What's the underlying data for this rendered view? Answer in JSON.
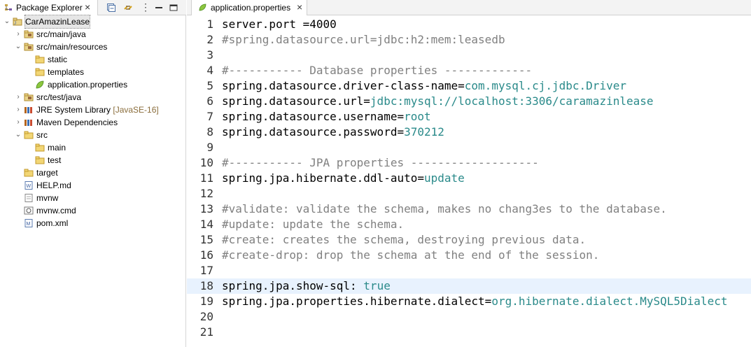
{
  "explorer": {
    "title": "Package Explorer",
    "close": "×",
    "tree": [
      {
        "label": "CarAmazinLease",
        "icon": "project-icon",
        "twisty": "⌄",
        "decoration": ""
      },
      {
        "label": "src/main/java",
        "icon": "source-folder-icon",
        "twisty": "›",
        "decoration": ""
      },
      {
        "label": "src/main/resources",
        "icon": "source-folder-icon",
        "twisty": "⌄",
        "decoration": ""
      },
      {
        "label": "static",
        "icon": "folder-icon",
        "twisty": "",
        "decoration": ""
      },
      {
        "label": "templates",
        "icon": "folder-icon",
        "twisty": "",
        "decoration": ""
      },
      {
        "label": "application.properties",
        "icon": "properties-file-icon",
        "twisty": "",
        "decoration": ""
      },
      {
        "label": "src/test/java",
        "icon": "source-folder-icon",
        "twisty": "›",
        "decoration": ""
      },
      {
        "label": "JRE System Library",
        "icon": "library-icon",
        "twisty": "›",
        "decoration": "[JavaSE-16]"
      },
      {
        "label": "Maven Dependencies",
        "icon": "library-icon",
        "twisty": "›",
        "decoration": ""
      },
      {
        "label": "src",
        "icon": "folder-icon",
        "twisty": "⌄",
        "decoration": ""
      },
      {
        "label": "main",
        "icon": "folder-icon",
        "twisty": "",
        "decoration": ""
      },
      {
        "label": "test",
        "icon": "folder-icon",
        "twisty": "",
        "decoration": ""
      },
      {
        "label": "target",
        "icon": "folder-icon",
        "twisty": "",
        "decoration": ""
      },
      {
        "label": "HELP.md",
        "icon": "markdown-file-icon",
        "twisty": "",
        "decoration": ""
      },
      {
        "label": "mvnw",
        "icon": "file-icon",
        "twisty": "",
        "decoration": ""
      },
      {
        "label": "mvnw.cmd",
        "icon": "cmd-file-icon",
        "twisty": "",
        "decoration": ""
      },
      {
        "label": "pom.xml",
        "icon": "xml-file-icon",
        "twisty": "",
        "decoration": ""
      }
    ]
  },
  "editor": {
    "tab_title": "application.properties",
    "close": "×",
    "highlighted_line": 18,
    "lines": [
      {
        "n": "1",
        "parts": [
          {
            "t": "server.port =4000",
            "c": "k"
          }
        ]
      },
      {
        "n": "2",
        "parts": [
          {
            "t": "#spring.datasource.url=jdbc:h2:mem:leasedb",
            "c": "cm"
          }
        ]
      },
      {
        "n": "3",
        "parts": []
      },
      {
        "n": "4",
        "parts": [
          {
            "t": "#----------- Database properties -------------",
            "c": "cm"
          }
        ]
      },
      {
        "n": "5",
        "parts": [
          {
            "t": "spring.datasource.driver-class-name=",
            "c": "k"
          },
          {
            "t": "com.mysql.cj.jdbc.Driver",
            "c": "v"
          }
        ]
      },
      {
        "n": "6",
        "parts": [
          {
            "t": "spring.datasource.url=",
            "c": "k"
          },
          {
            "t": "jdbc:mysql://localhost:3306/caramazinlease",
            "c": "v"
          }
        ]
      },
      {
        "n": "7",
        "parts": [
          {
            "t": "spring.datasource.username=",
            "c": "k"
          },
          {
            "t": "root",
            "c": "v"
          }
        ]
      },
      {
        "n": "8",
        "parts": [
          {
            "t": "spring.datasource.password=",
            "c": "k"
          },
          {
            "t": "370212",
            "c": "v"
          }
        ]
      },
      {
        "n": "9",
        "parts": []
      },
      {
        "n": "10",
        "parts": [
          {
            "t": "#----------- JPA properties -------------------",
            "c": "cm"
          }
        ]
      },
      {
        "n": "11",
        "parts": [
          {
            "t": "spring.jpa.hibernate.ddl-auto=",
            "c": "k"
          },
          {
            "t": "update",
            "c": "v"
          }
        ]
      },
      {
        "n": "12",
        "parts": []
      },
      {
        "n": "13",
        "parts": [
          {
            "t": "#validate: validate the schema, makes no chang3es to the database.",
            "c": "cm"
          }
        ]
      },
      {
        "n": "14",
        "parts": [
          {
            "t": "#update: update the schema.",
            "c": "cm"
          }
        ]
      },
      {
        "n": "15",
        "parts": [
          {
            "t": "#create: creates the schema, destroying previous data.",
            "c": "cm"
          }
        ]
      },
      {
        "n": "16",
        "parts": [
          {
            "t": "#create-drop: drop the schema at the end of the session.",
            "c": "cm"
          }
        ]
      },
      {
        "n": "17",
        "parts": []
      },
      {
        "n": "18",
        "parts": [
          {
            "t": "spring.jpa.show-sql: ",
            "c": "k"
          },
          {
            "t": "true",
            "c": "v"
          }
        ]
      },
      {
        "n": "19",
        "parts": [
          {
            "t": "spring.jpa.properties.hibernate.dialect=",
            "c": "k"
          },
          {
            "t": "org.hibernate.dialect.MySQL5Dialect",
            "c": "v"
          }
        ]
      },
      {
        "n": "20",
        "parts": []
      },
      {
        "n": "21",
        "parts": []
      }
    ]
  }
}
